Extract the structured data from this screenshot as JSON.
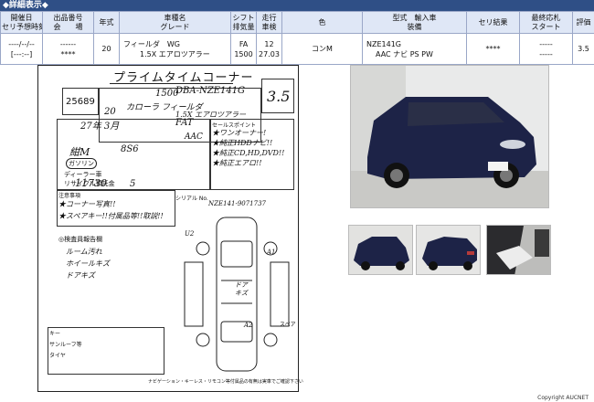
{
  "section_title": "◆詳細表示◆",
  "headers": [
    [
      "開催日",
      "セリ予想時刻"
    ],
    [
      "出品番号",
      "会　　場"
    ],
    [
      "年式",
      ""
    ],
    [
      "車種名",
      "グレード"
    ],
    [
      "シフト",
      "排気量"
    ],
    [
      "走行",
      "車検"
    ],
    [
      "色",
      ""
    ],
    [
      "型式　輸入車",
      "装備"
    ],
    [
      "セリ結果",
      ""
    ],
    [
      "最終応札",
      "スタート"
    ],
    [
      "評価",
      ""
    ]
  ],
  "row": {
    "date": "----/--/--",
    "time": "[---:--]",
    "lot": "------",
    "venue": "****",
    "year": "20",
    "car_name": "フィールダ　WG",
    "grade": "1.5X エアロツアラー",
    "shift": "FA",
    "displacement": "1500",
    "mileage": "12",
    "inspection": "27.03",
    "color": "コンM",
    "model_code": "NZE141G",
    "equipment": "AAC ナビ PS PW",
    "result": "****",
    "last_bid": "-----",
    "start": "-----",
    "score": "3.5"
  },
  "sheet": {
    "title": "プライムタイムコーナー",
    "lot_no": "25689",
    "cc": "1500",
    "model": "DBA-NZE141G",
    "score": "3.5",
    "year": "20",
    "name": "カローラ フィールダ",
    "grade": "1.5X エアロツアラー",
    "inspection": "27年 3月",
    "shift": "FAT",
    "ac": "AAC",
    "color": "紺M",
    "color_code": "8S6",
    "fuel": "ガソリン",
    "km": "11730",
    "seats": "5",
    "chassis_no": "NZE141-9071737",
    "points_lines": [
      "★ワンオーナー!",
      "★純正HDDナビ!!",
      "★純正CD,HD,DVD!!",
      "★純正エアロ!!"
    ],
    "notes_lines": [
      "★コーナー写真!!",
      "★スペアキー!!付属品等!!取説!!"
    ],
    "remarks_lines": [
      "ルーム汚れ",
      "ホイールキズ",
      "ドアキズ"
    ],
    "inspection_title": "◎検査員報告欄",
    "footnote": "ナビゲーション・キーレス・リモコン等付属品の有無は実車でご確認下さい",
    "lbl_serial": "シリアル No.",
    "lbl_sunroof": "サンルーフ等",
    "lbl_recycle": "リサイクル預託金",
    "lbl_note": "注意事項",
    "lbl_dealer": "ディーラー車",
    "lbl_spare": "スペア",
    "lbl_keys": "キー",
    "lbl_points": "セールスポイント",
    "lbl_tires": "タイヤ",
    "body_note_1": "ドア",
    "body_note_2": "キズ",
    "body_note_3": "U2",
    "body_note_4": "A1",
    "body_note_5": "A2"
  },
  "footer_text": "Copyright AUCNET"
}
